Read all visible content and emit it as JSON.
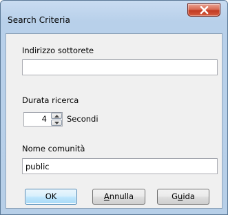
{
  "window": {
    "title": "Search Criteria",
    "close_icon": "close-icon"
  },
  "form": {
    "subnet_label": "Indirizzo sottorete",
    "subnet_value": "",
    "duration_label": "Durata ricerca",
    "duration_value": "4",
    "duration_unit": "Secondi",
    "community_label": "Nome comunità",
    "community_value": "public"
  },
  "buttons": {
    "ok": "OK",
    "cancel_prefix": "",
    "cancel_mnemonic": "A",
    "cancel_rest": "nnulla",
    "help_prefix": "G",
    "help_mnemonic": "u",
    "help_rest": "ida"
  }
}
